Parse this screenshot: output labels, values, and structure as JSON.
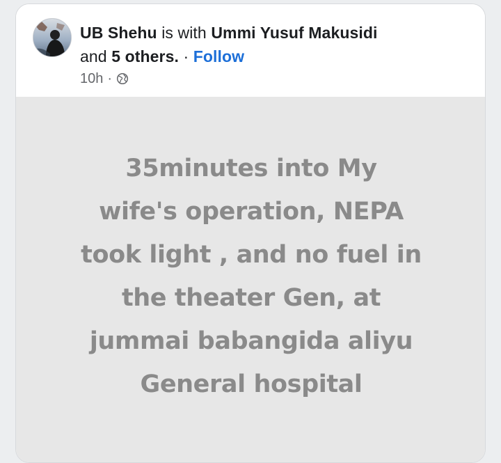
{
  "post": {
    "author": "UB Shehu",
    "with_text": "is with",
    "tagged_person": "Ummi Yusuf Makusidi",
    "and_text": "and",
    "others": "5 others.",
    "separator": "·",
    "follow_label": "Follow",
    "time": "10h",
    "time_separator": "·",
    "privacy_icon": "globe-icon",
    "body_text": "35minutes into My\nwife's operation, NEPA\ntook light , and no fuel in\nthe theater Gen, at\njummai babangida aliyu\nGeneral hospital"
  },
  "colors": {
    "follow": "#1d6fd8",
    "post_text": "#8a8a8a",
    "post_background": "#e7e7e7"
  }
}
